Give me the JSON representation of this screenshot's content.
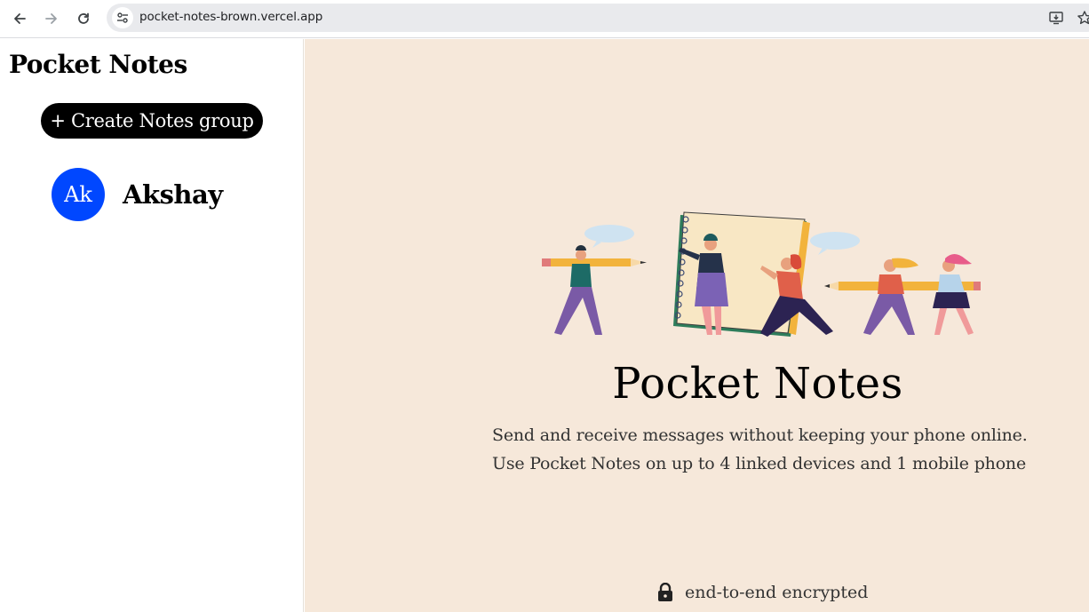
{
  "browser": {
    "url": "pocket-notes-brown.vercel.app"
  },
  "sidebar": {
    "title": "Pocket Notes",
    "create_button_label": "+ Create Notes group",
    "groups": [
      {
        "initials": "Ak",
        "name": "Akshay",
        "color": "#0047ff"
      }
    ]
  },
  "main": {
    "title": "Pocket Notes",
    "description_lines": [
      "Send and receive messages without keeping your phone online.",
      "Use Pocket Notes on up to 4 linked devices and 1 mobile phone"
    ],
    "footer_text": "end-to-end encrypted",
    "background_color": "#f6e8da"
  },
  "icons": [
    "back-arrow-icon",
    "forward-arrow-icon",
    "reload-icon",
    "site-info-icon",
    "install-app-icon",
    "bookmark-star-icon",
    "lock-icon"
  ]
}
